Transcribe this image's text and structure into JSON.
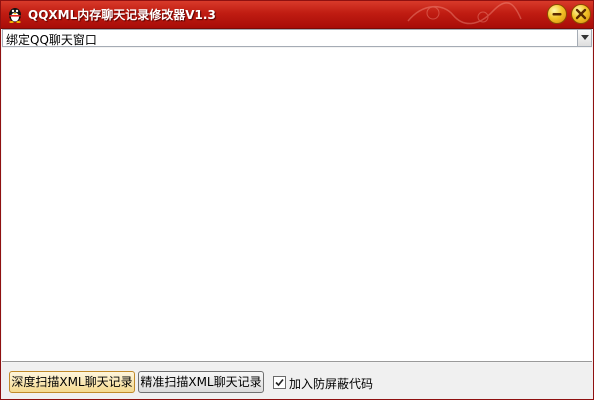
{
  "window": {
    "title": "QQXML内存聊天记录修改器V1.3",
    "app_icon": "penguin-icon",
    "minimize_icon": "minimize-icon",
    "close_icon": "close-icon"
  },
  "combo": {
    "selected": "绑定QQ聊天窗口",
    "arrow_icon": "chevron-down-icon"
  },
  "buttons": {
    "deep_scan": "深度扫描XML聊天记录",
    "precise_scan": "精准扫描XML聊天记录"
  },
  "checkbox": {
    "label": "加入防屏蔽代码",
    "checked": true
  },
  "colors": {
    "titlebar": "#c01c12",
    "title_button": "#f3c52a"
  }
}
